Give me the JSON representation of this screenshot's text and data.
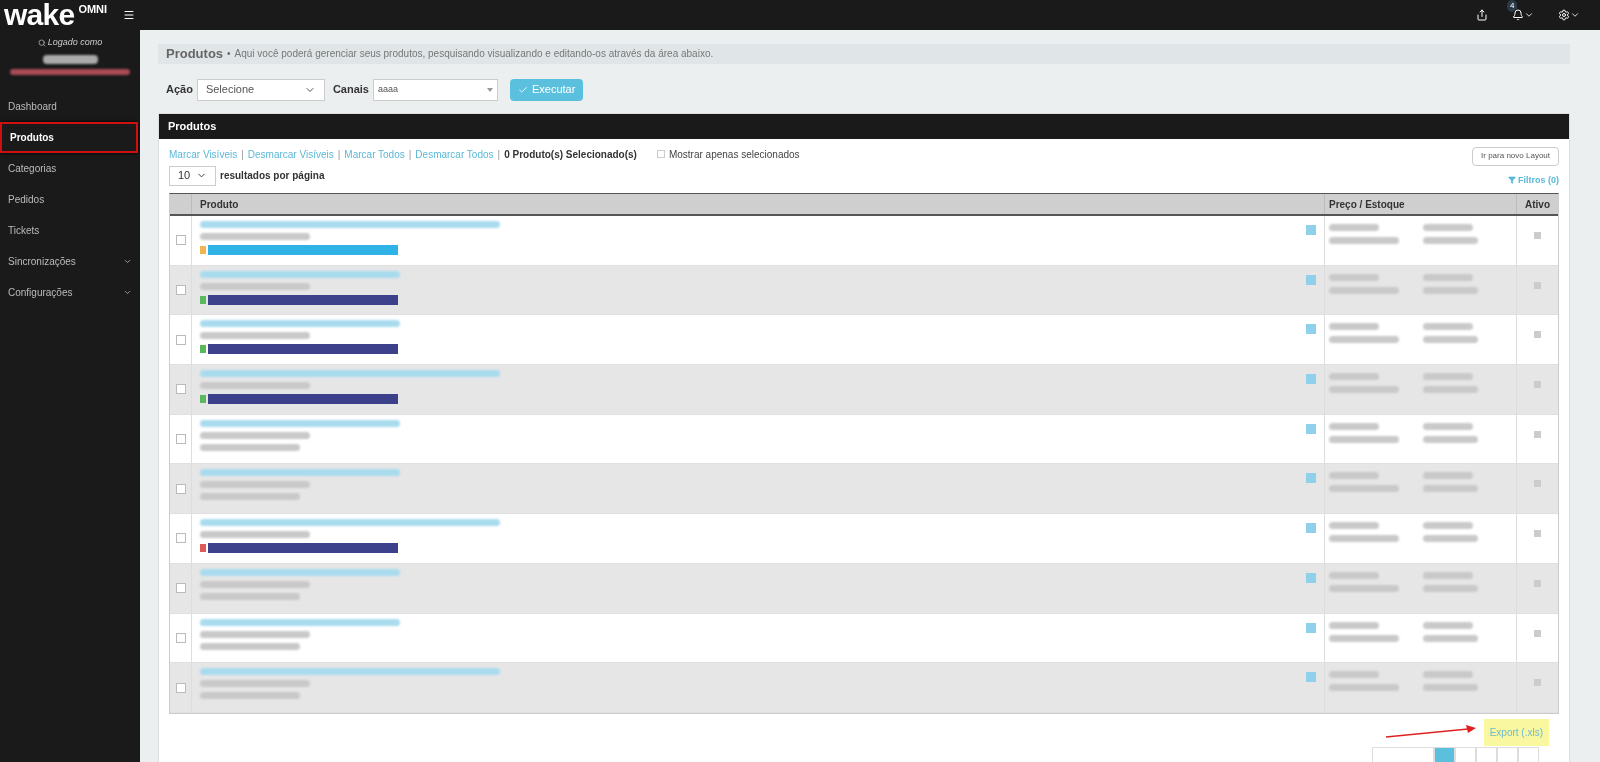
{
  "topbar": {
    "logo": "wake",
    "logo_suffix": "OMNI",
    "notification_count": "4"
  },
  "sidebar": {
    "logged_as": "Logado como",
    "items": [
      {
        "label": "Dashboard",
        "selected": false,
        "expandable": false
      },
      {
        "label": "Produtos",
        "selected": true,
        "expandable": false
      },
      {
        "label": "Categorias",
        "selected": false,
        "expandable": false
      },
      {
        "label": "Pedidos",
        "selected": false,
        "expandable": false
      },
      {
        "label": "Tickets",
        "selected": false,
        "expandable": false
      },
      {
        "label": "Sincronizações",
        "selected": false,
        "expandable": true
      },
      {
        "label": "Configurações",
        "selected": false,
        "expandable": true
      }
    ]
  },
  "page_header": {
    "title": "Produtos",
    "bullet": "•",
    "description": "Aqui você poderá gerenciar seus produtos, pesquisando visualizando e editando-os através da área abaixo."
  },
  "toolbar": {
    "action_label": "Ação",
    "action_value": "Selecione",
    "channels_label": "Canais",
    "channels_value": "aaaa",
    "execute_button": "Executar"
  },
  "panel": {
    "title": "Produtos",
    "selection_links": [
      "Marcar Visíveis",
      "Desmarcar Visíveis",
      "Marcar Todos",
      "Desmarcar Todos"
    ],
    "link_separator": "|",
    "selected_count": "0 Produto(s) Selecionado(s)",
    "show_selected_only": {
      "label": "Mostrar apenas selecionados",
      "checked": false
    },
    "new_layout_button": "Ir para novo Layout",
    "page_size": "10",
    "page_size_label": "resultados por página",
    "filters": "Filtros (0)",
    "table": {
      "columns": [
        "Produto",
        "Preço / Estoque",
        "Ativo"
      ],
      "rows": [
        {
          "checked": false,
          "kind": "tagged",
          "dot": {
            "color": "#f2b552"
          },
          "tag": {
            "color": "#2fb3e6"
          }
        },
        {
          "checked": false,
          "kind": "tagged",
          "dot": {
            "color": "#5cb85c"
          },
          "tag": {
            "color": "#3d418c"
          }
        },
        {
          "checked": false,
          "kind": "tagged",
          "dot": {
            "color": "#5cb85c"
          },
          "tag": {
            "color": "#3d418c"
          }
        },
        {
          "checked": false,
          "kind": "tagged",
          "dot": {
            "color": "#5cb85c"
          },
          "tag": {
            "color": "#3d418c"
          }
        },
        {
          "checked": false,
          "kind": "plain"
        },
        {
          "checked": false,
          "kind": "plain"
        },
        {
          "checked": false,
          "kind": "tagged",
          "dot": {
            "color": "#e05a5a"
          },
          "tag": {
            "color": "#3d418c"
          }
        },
        {
          "checked": false,
          "kind": "plain"
        },
        {
          "checked": false,
          "kind": "plain"
        },
        {
          "checked": false,
          "kind": "plain"
        }
      ]
    },
    "export_link": "Export (.xls)",
    "pagination": [
      {
        "selected": false
      },
      {
        "selected": true
      },
      {
        "selected": false
      },
      {
        "selected": false
      },
      {
        "selected": false
      },
      {
        "selected": false
      }
    ]
  }
}
